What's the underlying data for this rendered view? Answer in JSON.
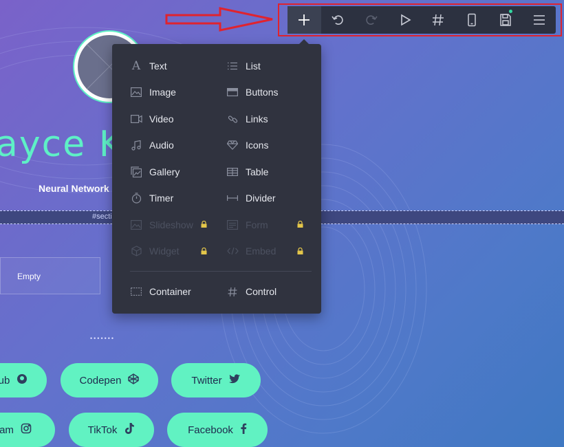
{
  "page": {
    "hero_name": "ayce K",
    "subtitle": "Neural Network",
    "section_tag": "#sectio",
    "empty_label": "Empty",
    "dots": "•••••••"
  },
  "toolbar": {
    "buttons": [
      {
        "icon": "plus-icon",
        "active": true
      },
      {
        "icon": "undo-icon"
      },
      {
        "icon": "redo-icon",
        "disabled": true
      },
      {
        "icon": "play-icon"
      },
      {
        "icon": "hash-icon"
      },
      {
        "icon": "mobile-icon"
      },
      {
        "icon": "save-icon",
        "has_dot": true
      },
      {
        "icon": "menu-icon"
      }
    ],
    "accent_dot_color": "#33d8a0"
  },
  "menu": {
    "left": [
      {
        "label": "Text",
        "icon": "text-icon"
      },
      {
        "label": "Image",
        "icon": "image-icon"
      },
      {
        "label": "Video",
        "icon": "video-icon"
      },
      {
        "label": "Audio",
        "icon": "audio-icon"
      },
      {
        "label": "Gallery",
        "icon": "gallery-icon"
      },
      {
        "label": "Timer",
        "icon": "timer-icon"
      },
      {
        "label": "Slideshow",
        "icon": "slideshow-icon",
        "locked": true
      },
      {
        "label": "Widget",
        "icon": "widget-icon",
        "locked": true
      }
    ],
    "right": [
      {
        "label": "List",
        "icon": "list-icon"
      },
      {
        "label": "Buttons",
        "icon": "buttons-icon"
      },
      {
        "label": "Links",
        "icon": "links-icon"
      },
      {
        "label": "Icons",
        "icon": "diamond-icon"
      },
      {
        "label": "Table",
        "icon": "table-icon"
      },
      {
        "label": "Divider",
        "icon": "divider-icon"
      },
      {
        "label": "Form",
        "icon": "form-icon",
        "locked": true
      },
      {
        "label": "Embed",
        "icon": "embed-icon",
        "locked": true
      }
    ],
    "bottom": [
      {
        "label": "Container",
        "icon": "container-icon"
      },
      {
        "label": "Control",
        "icon": "hash-icon"
      }
    ]
  },
  "social": [
    {
      "label": "ub",
      "icon": "github-icon"
    },
    {
      "label": "Codepen",
      "icon": "codepen-icon"
    },
    {
      "label": "Twitter",
      "icon": "twitter-icon"
    },
    {
      "label": "ram",
      "icon": "instagram-icon"
    },
    {
      "label": "TikTok",
      "icon": "tiktok-icon"
    },
    {
      "label": "Facebook",
      "icon": "facebook-icon"
    }
  ],
  "colors": {
    "accent_mint": "#5ef0c6",
    "button_mint": "#61f2c2",
    "toolbar_bg": "#2c3140",
    "menu_bg": "#30333f",
    "highlight_red": "#e0232e"
  }
}
